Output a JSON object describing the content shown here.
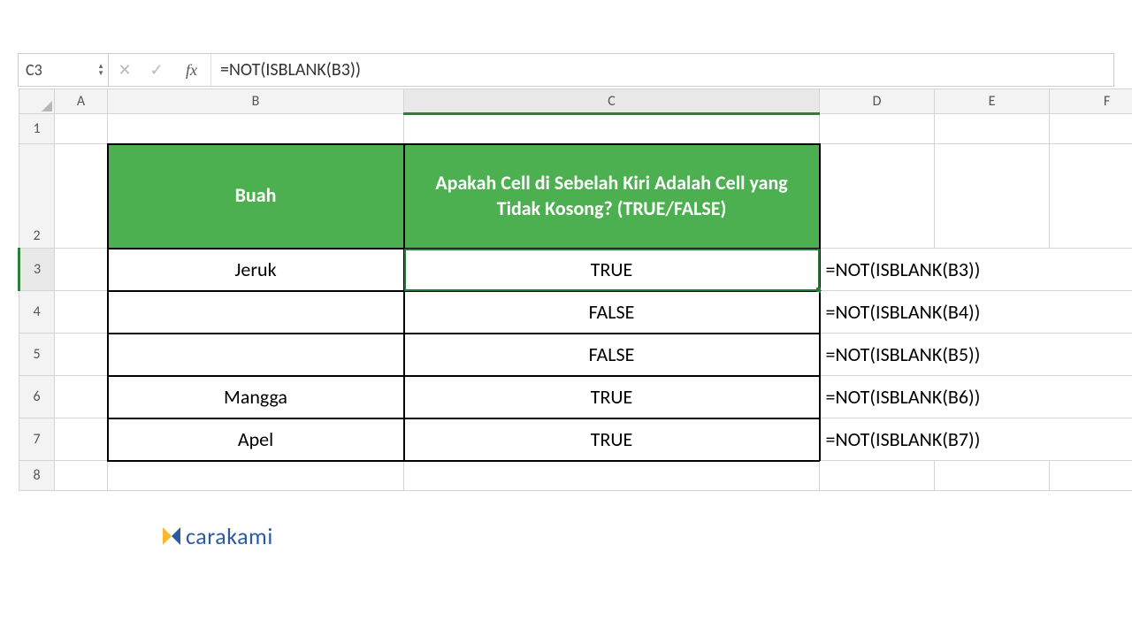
{
  "formula_bar": {
    "cell_ref": "C3",
    "formula": "=NOT(ISBLANK(B3))"
  },
  "columns": [
    "A",
    "B",
    "C",
    "D",
    "E",
    "F"
  ],
  "row_numbers": [
    "1",
    "2",
    "3",
    "4",
    "5",
    "6",
    "7",
    "8"
  ],
  "table": {
    "header_b": "Buah",
    "header_c": "Apakah Cell di Sebelah Kiri Adalah Cell yang Tidak Kosong? (TRUE/FALSE)",
    "rows": [
      {
        "fruit": "Jeruk",
        "result": "TRUE",
        "formula": "=NOT(ISBLANK(B3))"
      },
      {
        "fruit": "",
        "result": "FALSE",
        "formula": "=NOT(ISBLANK(B4))"
      },
      {
        "fruit": "",
        "result": "FALSE",
        "formula": "=NOT(ISBLANK(B5))"
      },
      {
        "fruit": "Mangga",
        "result": "TRUE",
        "formula": "=NOT(ISBLANK(B6))"
      },
      {
        "fruit": "Apel",
        "result": "TRUE",
        "formula": "=NOT(ISBLANK(B7))"
      }
    ]
  },
  "brand": "carakami"
}
